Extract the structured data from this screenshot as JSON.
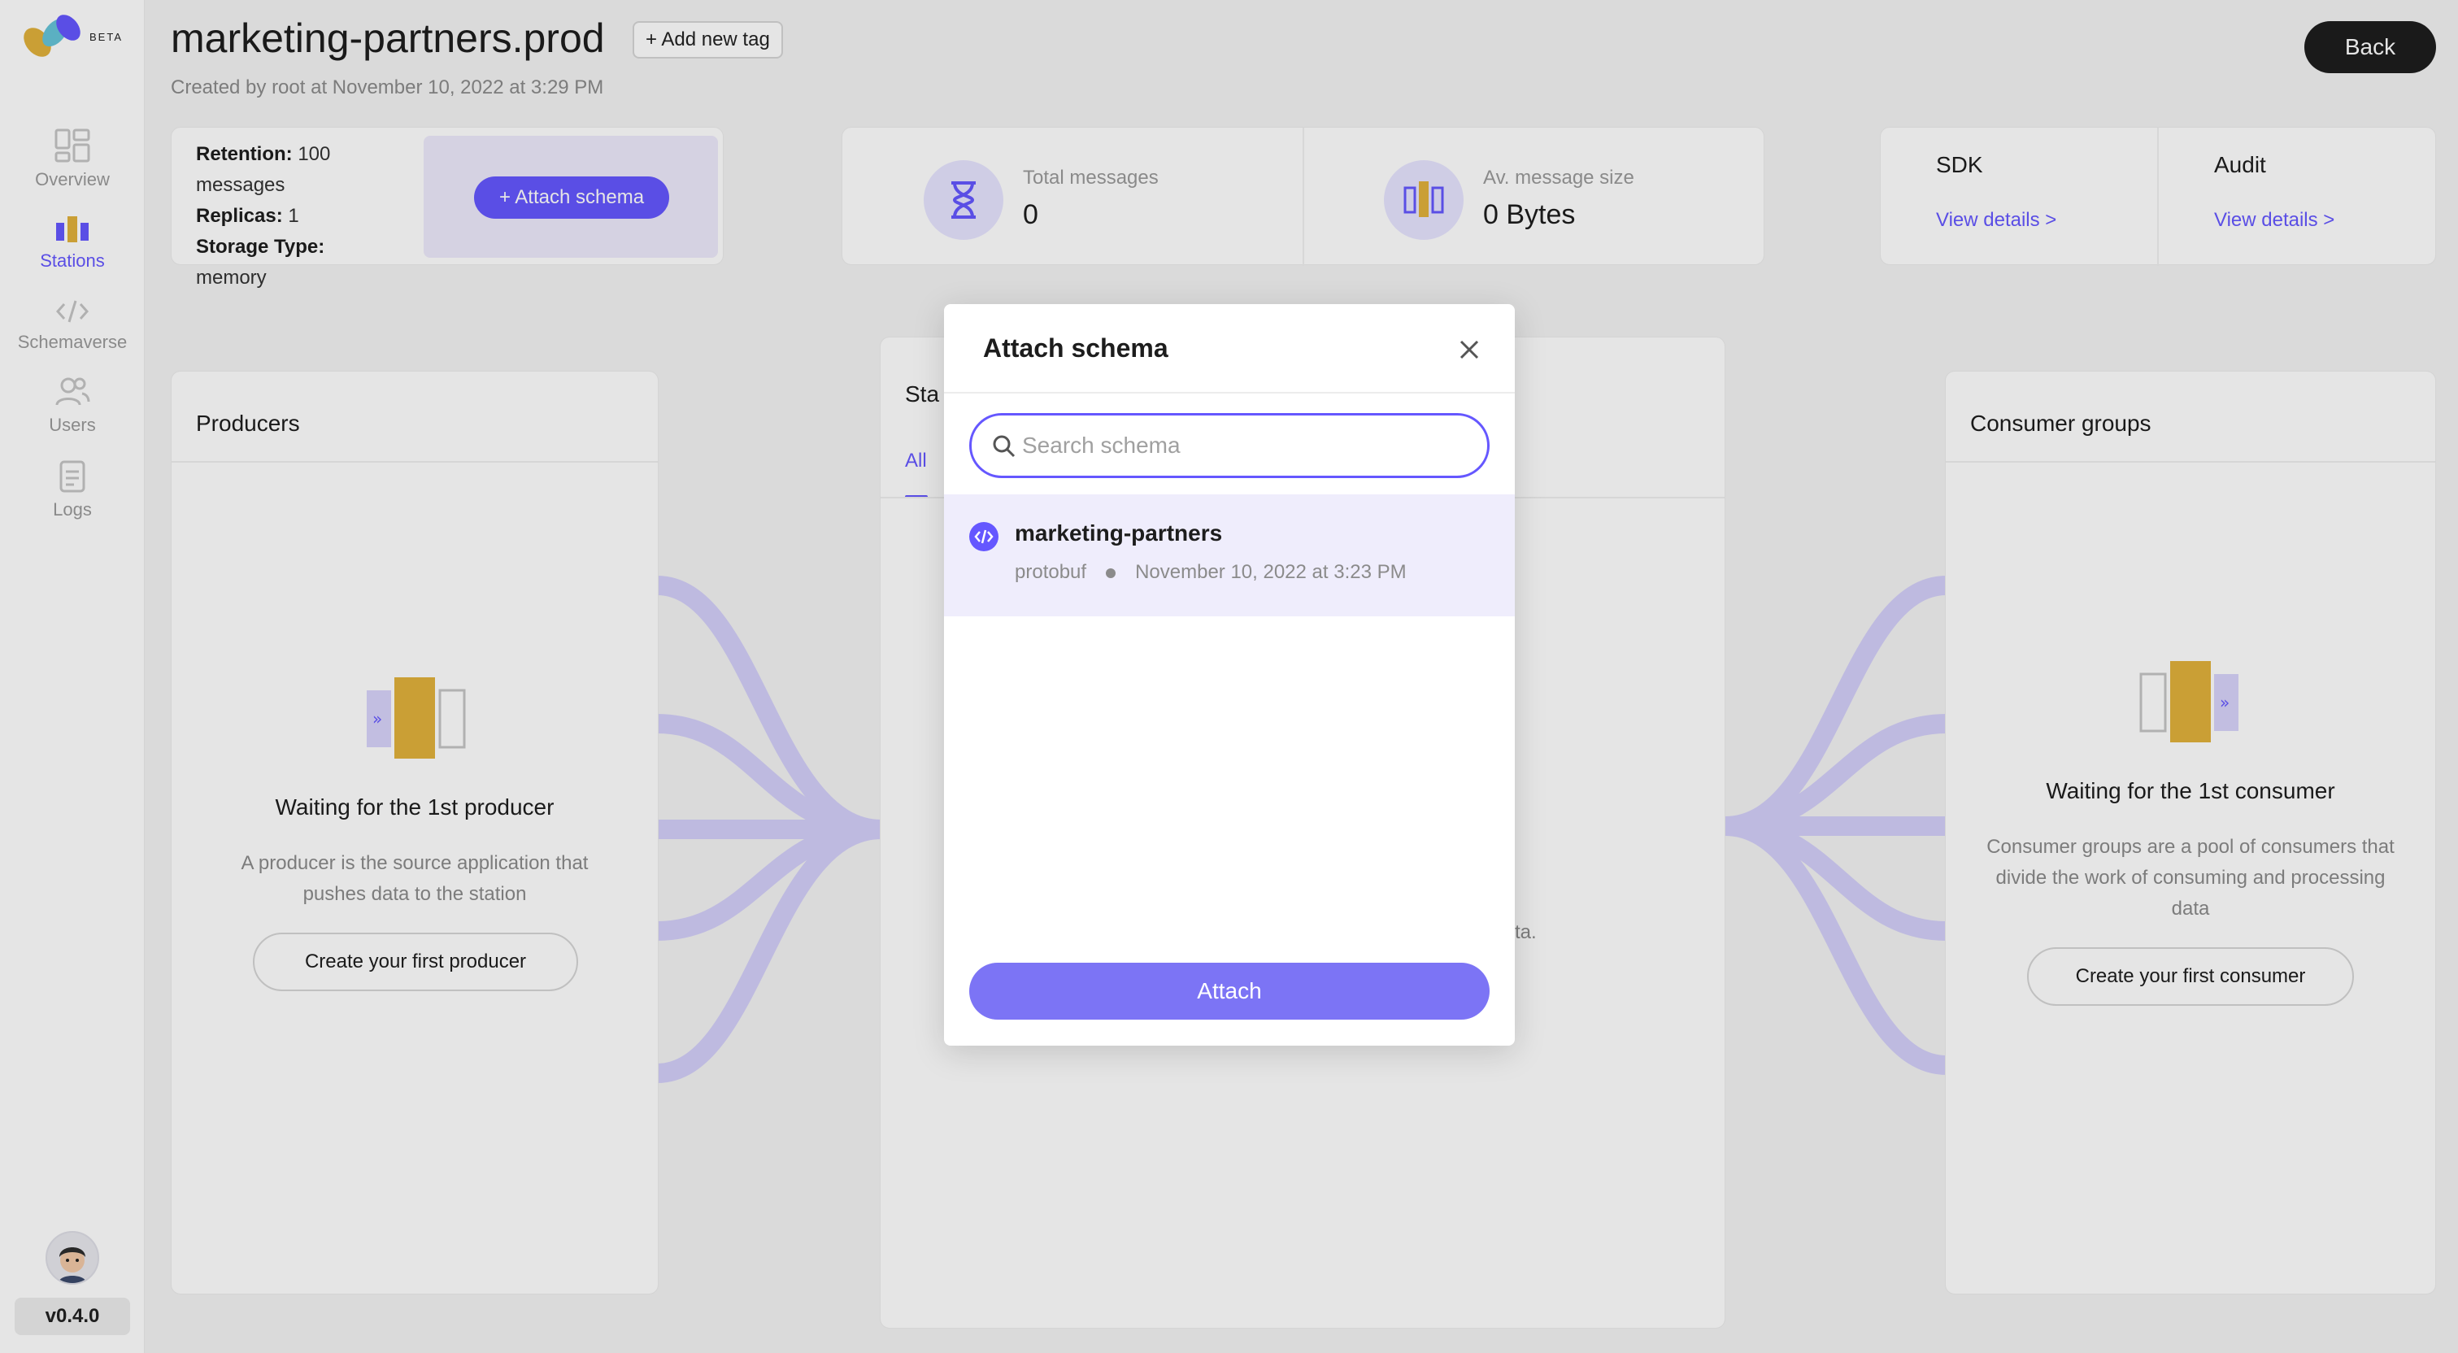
{
  "sidebar": {
    "beta": "BETA",
    "items": [
      {
        "label": "Overview",
        "icon": "overview-icon",
        "active": false
      },
      {
        "label": "Stations",
        "icon": "stations-icon",
        "active": true
      },
      {
        "label": "Schemaverse",
        "icon": "code-icon",
        "active": false
      },
      {
        "label": "Users",
        "icon": "users-icon",
        "active": false
      },
      {
        "label": "Logs",
        "icon": "logs-icon",
        "active": false
      }
    ],
    "version": "v0.4.0"
  },
  "header": {
    "title": "marketing-partners.prod",
    "add_tag": "Add new tag",
    "created": "Created by root at November 10, 2022 at 3:29 PM",
    "back": "Back"
  },
  "info": {
    "retention_label": "Retention:",
    "retention_value": "100 messages",
    "replicas_label": "Replicas:",
    "replicas_value": "1",
    "storage_label": "Storage Type:",
    "storage_value": "memory",
    "attach_schema": "Attach schema"
  },
  "stats": {
    "total_label": "Total messages",
    "total_value": "0",
    "size_label": "Av. message size",
    "size_value": "0 Bytes"
  },
  "links": {
    "sdk_title": "SDK",
    "sdk_link": "View details >",
    "audit_title": "Audit",
    "audit_link": "View details >"
  },
  "producers": {
    "title": "Producers",
    "wait_title": "Waiting for the 1st producer",
    "desc": "A producer is the source application that pushes data to the station",
    "button": "Create your first producer"
  },
  "station": {
    "title": "Sta",
    "tab": "All",
    "fragment": "ta."
  },
  "consumers": {
    "title": "Consumer groups",
    "wait_title": "Waiting for the 1st consumer",
    "desc": "Consumer groups are a pool of consumers that divide the work of consuming and processing data",
    "button": "Create your first consumer"
  },
  "modal": {
    "title": "Attach schema",
    "search_placeholder": "Search schema",
    "search_value": "",
    "schema": {
      "name": "marketing-partners",
      "type": "protobuf",
      "date": "November 10, 2022 at 3:23 PM"
    },
    "attach": "Attach"
  },
  "colors": {
    "accent": "#6557ff",
    "gold": "#e1b13b",
    "dark": "#1d1d1d"
  }
}
